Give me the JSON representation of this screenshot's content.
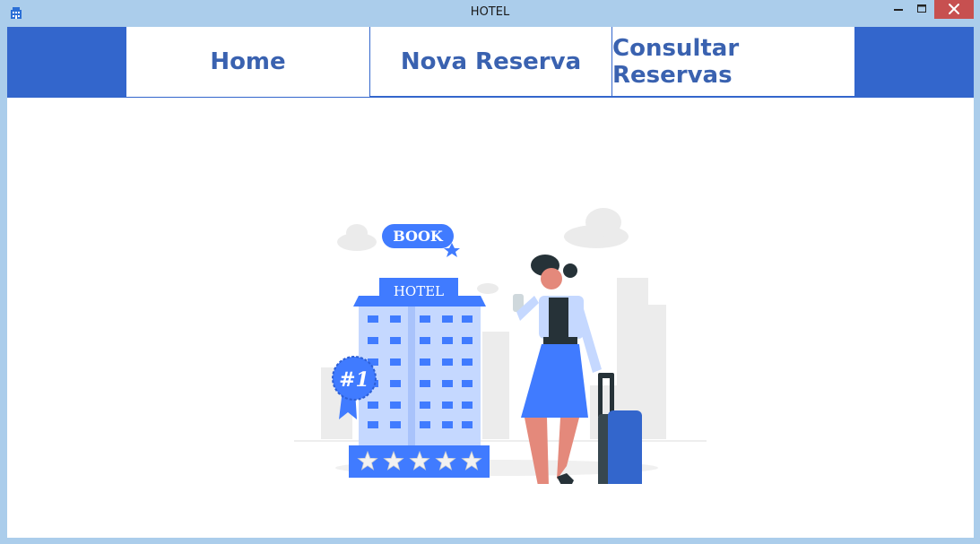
{
  "window": {
    "title": "HOTEL",
    "icon": "hotel-building-icon"
  },
  "tabs": [
    {
      "label": "Home",
      "selected": true
    },
    {
      "label": "Nova Reserva",
      "selected": false
    },
    {
      "label": "Consultar Reservas",
      "selected": false
    }
  ],
  "illustration": {
    "book_badge": "BOOK",
    "hotel_sign": "HOTEL",
    "rank_badge": "#1",
    "stars": 5
  },
  "colors": {
    "accent": "#3366cc",
    "tab_text": "#3a62b0",
    "titlebar": "#abcdeb",
    "close": "#c75050",
    "illustration_blue": "#407bff"
  }
}
